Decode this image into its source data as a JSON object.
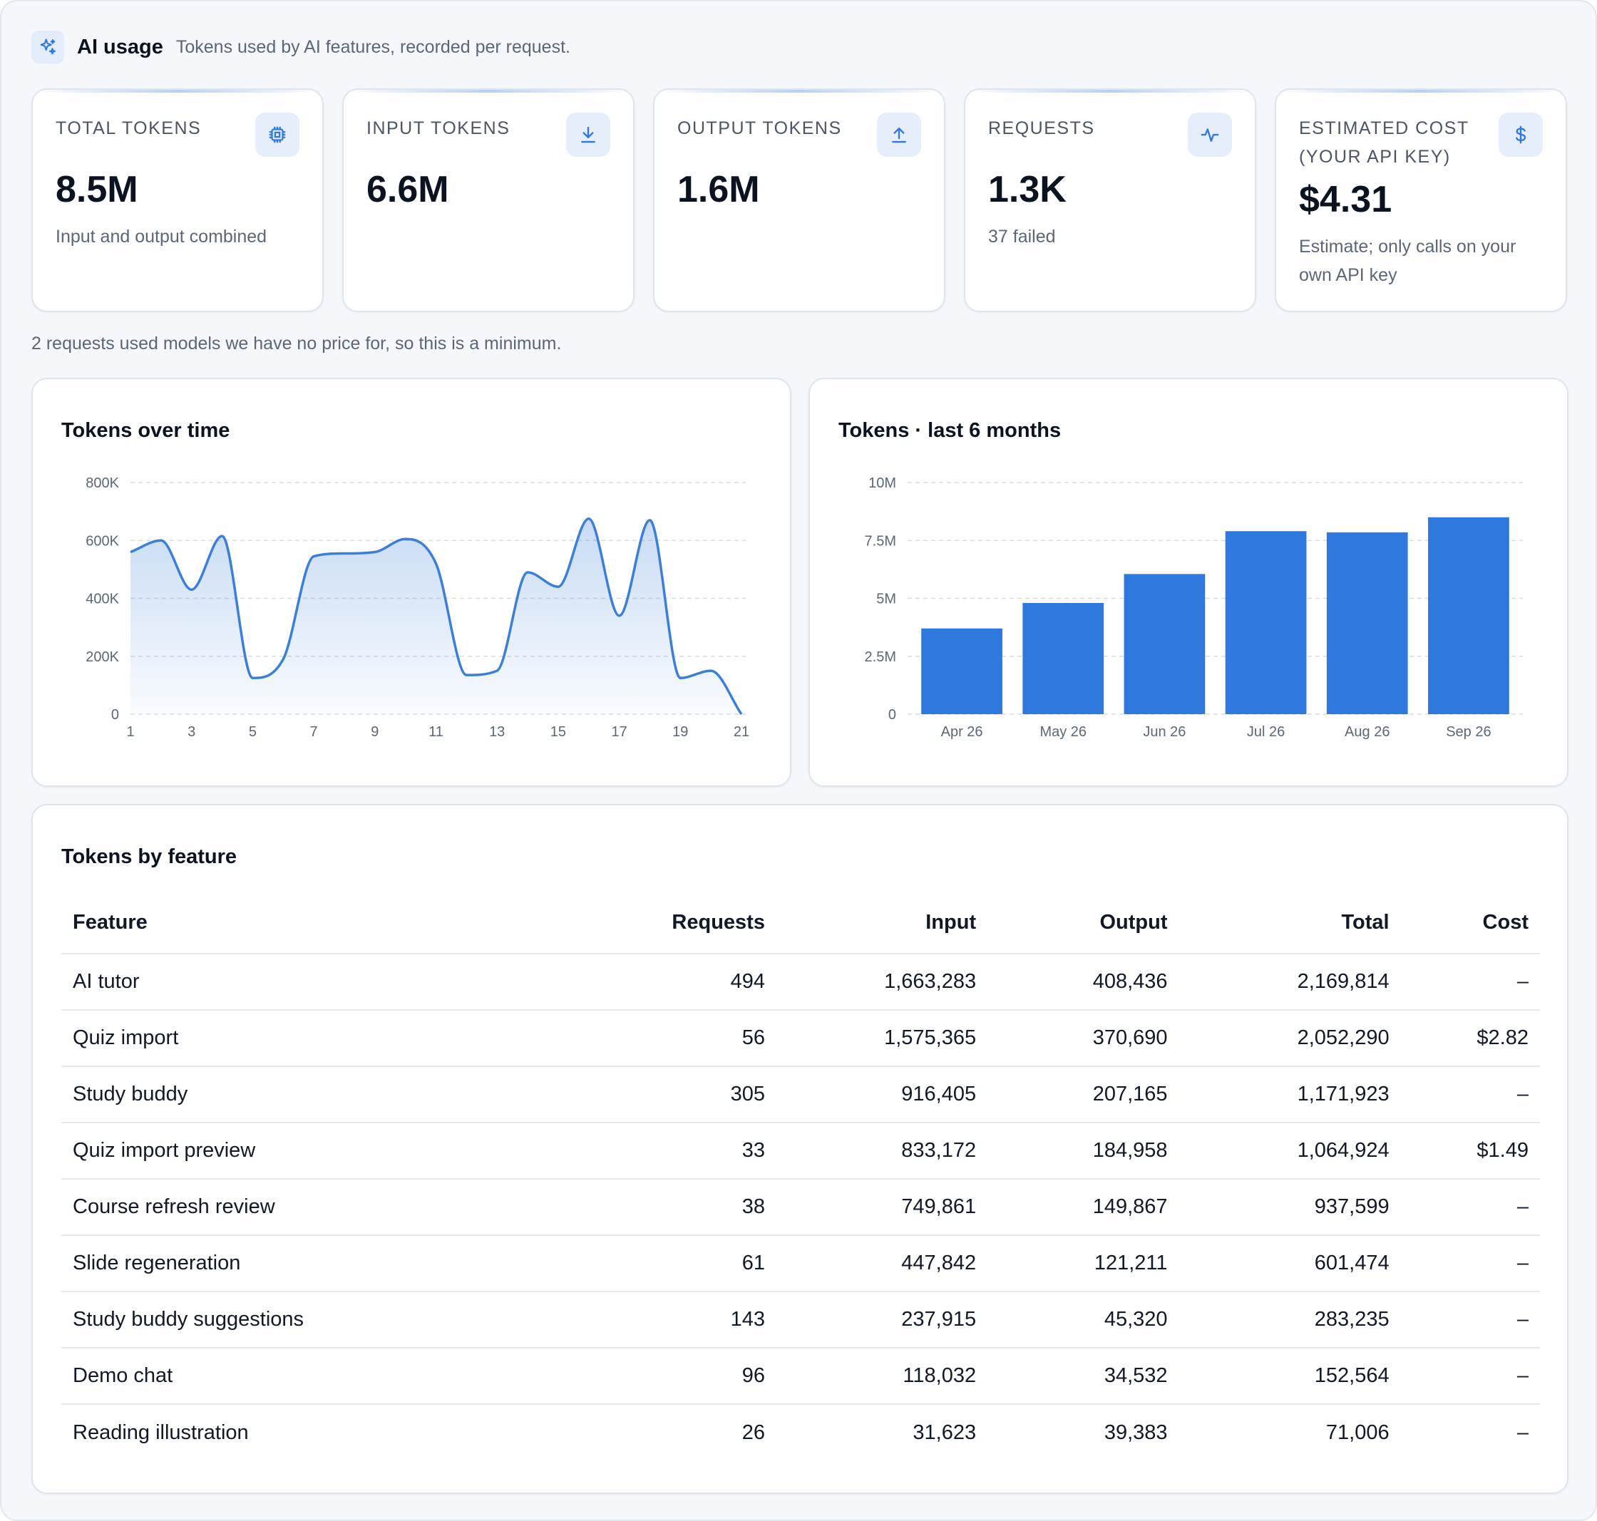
{
  "header": {
    "title": "AI usage",
    "subtitle": "Tokens used by AI features, recorded per request.",
    "icon": "sparkles-icon"
  },
  "stats": [
    {
      "label": "TOTAL TOKENS",
      "value": "8.5M",
      "sub": "Input and output combined",
      "icon": "chip-icon"
    },
    {
      "label": "INPUT TOKENS",
      "value": "6.6M",
      "sub": "",
      "icon": "download-icon"
    },
    {
      "label": "OUTPUT TOKENS",
      "value": "1.6M",
      "sub": "",
      "icon": "upload-icon"
    },
    {
      "label": "REQUESTS",
      "value": "1.3K",
      "sub": "37 failed",
      "icon": "activity-icon"
    },
    {
      "label": "ESTIMATED COST (YOUR API KEY)",
      "value": "$4.31",
      "sub": "Estimate; only calls on your own API key",
      "icon": "dollar-icon"
    }
  ],
  "note": "2 requests used models we have no price for, so this is a minimum.",
  "colors": {
    "accent": "#2f78de",
    "line": "#3b7fd9",
    "grid": "#d7dce4",
    "axis_text": "#5b6678"
  },
  "chart_data": [
    {
      "type": "area",
      "title": "Tokens over time",
      "x": [
        1,
        2,
        3,
        4,
        5,
        6,
        7,
        8,
        9,
        10,
        11,
        12,
        13,
        14,
        15,
        16,
        17,
        18,
        19,
        20,
        21
      ],
      "x_tick_labels": [
        "1",
        "3",
        "5",
        "7",
        "9",
        "11",
        "13",
        "15",
        "17",
        "19",
        "21"
      ],
      "values": [
        560000,
        600000,
        430000,
        615000,
        125000,
        190000,
        545000,
        555000,
        560000,
        605000,
        520000,
        135000,
        150000,
        490000,
        440000,
        675000,
        340000,
        670000,
        125000,
        150000,
        0
      ],
      "ylim": [
        0,
        800000
      ],
      "y_ticks": [
        "0",
        "200K",
        "400K",
        "600K",
        "800K"
      ],
      "y_tick_values": [
        0,
        200000,
        400000,
        600000,
        800000
      ],
      "grid": true
    },
    {
      "type": "bar",
      "title": "Tokens · last 6 months",
      "categories": [
        "Apr 26",
        "May 26",
        "Jun 26",
        "Jul 26",
        "Aug 26",
        "Sep 26"
      ],
      "values": [
        3700000,
        4800000,
        6050000,
        7900000,
        7850000,
        8500000
      ],
      "ylim": [
        0,
        10000000
      ],
      "y_ticks": [
        "0",
        "2.5M",
        "5M",
        "7.5M",
        "10M"
      ],
      "y_tick_values": [
        0,
        2500000,
        5000000,
        7500000,
        10000000
      ],
      "grid": true
    }
  ],
  "table": {
    "title": "Tokens by feature",
    "columns": [
      "Feature",
      "Requests",
      "Input",
      "Output",
      "Total",
      "Cost"
    ],
    "rows": [
      [
        "AI tutor",
        "494",
        "1,663,283",
        "408,436",
        "2,169,814",
        "–"
      ],
      [
        "Quiz import",
        "56",
        "1,575,365",
        "370,690",
        "2,052,290",
        "$2.82"
      ],
      [
        "Study buddy",
        "305",
        "916,405",
        "207,165",
        "1,171,923",
        "–"
      ],
      [
        "Quiz import preview",
        "33",
        "833,172",
        "184,958",
        "1,064,924",
        "$1.49"
      ],
      [
        "Course refresh review",
        "38",
        "749,861",
        "149,867",
        "937,599",
        "–"
      ],
      [
        "Slide regeneration",
        "61",
        "447,842",
        "121,211",
        "601,474",
        "–"
      ],
      [
        "Study buddy suggestions",
        "143",
        "237,915",
        "45,320",
        "283,235",
        "–"
      ],
      [
        "Demo chat",
        "96",
        "118,032",
        "34,532",
        "152,564",
        "–"
      ],
      [
        "Reading illustration",
        "26",
        "31,623",
        "39,383",
        "71,006",
        "–"
      ]
    ]
  }
}
